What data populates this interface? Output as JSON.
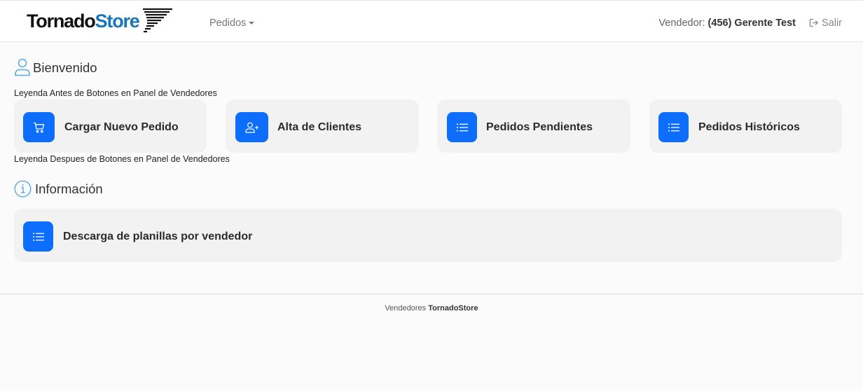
{
  "header": {
    "logo": {
      "part1": "Tornado",
      "part2": "Store"
    },
    "menu_label": "Pedidos",
    "vendor_label": "Vendedor:",
    "vendor_value": "(456) Gerente Test",
    "logout_label": "Salir"
  },
  "welcome": {
    "title": "Bienvenido",
    "legend_before": "Leyenda Antes de Botones en Panel de Vendedores",
    "legend_after": "Leyenda Despues de Botones en Panel de Vendedores",
    "buttons": [
      {
        "label": "Cargar Nuevo Pedido",
        "icon": "cart-icon"
      },
      {
        "label": "Alta de Clientes",
        "icon": "user-plus-icon"
      },
      {
        "label": "Pedidos Pendientes",
        "icon": "list-icon"
      },
      {
        "label": "Pedidos Históricos",
        "icon": "list-icon"
      }
    ]
  },
  "info": {
    "title": "Información",
    "buttons": [
      {
        "label": "Descarga de planillas por vendedor",
        "icon": "list-icon"
      }
    ]
  },
  "footer": {
    "prefix": "Vendedores",
    "brand": "TornadoStore"
  },
  "colors": {
    "accent": "#0d6efd",
    "brand_blue": "#1a75bb",
    "card_bg": "#f2f2f2",
    "section_icon": "#5aa8dc"
  }
}
